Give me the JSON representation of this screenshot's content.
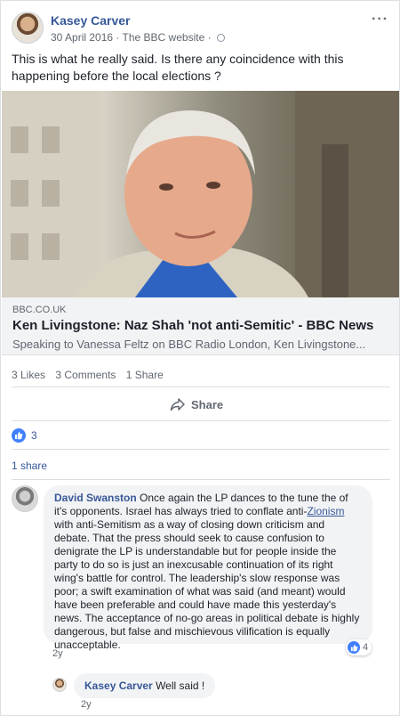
{
  "post": {
    "author": "Kasey Carver",
    "date": "30 April 2016",
    "source": "The BBC website",
    "more_icon": "···",
    "text": "This is what he really said. Is there any coincidence with this happening before the local elections ?"
  },
  "link": {
    "domain": "BBC.CO.UK",
    "title": "Ken Livingstone: Naz Shah 'not anti-Semitic' - BBC News",
    "description": "Speaking to Vanessa Feltz on BBC Radio London, Ken Livingstone..."
  },
  "stats": {
    "likes": "3 Likes",
    "comments": "3 Comments",
    "shares": "1 Share"
  },
  "actions": {
    "share_label": "Share"
  },
  "reactions": {
    "count": "3",
    "shares_text": "1 share"
  },
  "comments": [
    {
      "author": "David Swanston",
      "text_a": " Once again the LP dances to the tune the of it's opponents. Israel has always tried to conflate anti-",
      "link_word": "Zionism",
      "text_b": " with anti-Semitism as a way of closing down criticism and debate. That the press should seek to cause confusion to denigrate the LP is understandable but for people inside the party to do so is just an inexcusable continuation of its right wing's battle for control. The leadership's slow response was poor; a swift examination of what was said (and meant) would have been preferable and could have made this yesterday's news. The acceptance of no-go areas in political debate is highly dangerous, but false and mischievous vilification is equally unacceptable.",
      "time": "2y",
      "reactions": "4"
    },
    {
      "author": "Kasey Carver",
      "text": " Well said !",
      "time": "2y"
    }
  ],
  "colors": {
    "link_blue": "#365899",
    "like_blue": "#4080ff",
    "bubble_bg": "#f2f3f5"
  }
}
